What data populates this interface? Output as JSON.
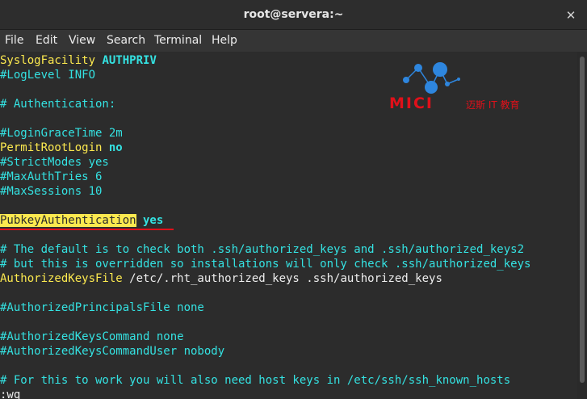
{
  "window": {
    "title": "root@servera:~",
    "close_glyph": "✕"
  },
  "menubar": {
    "items": [
      "File",
      "Edit",
      "View",
      "Search",
      "Terminal",
      "Help"
    ]
  },
  "terminal": {
    "lines": {
      "l01_key": "SyslogFacility",
      "l01_val": " AUTHPRIV",
      "l02": "#LogLevel INFO",
      "l04": "# Authentication:",
      "l06": "#LoginGraceTime 2m",
      "l07_key": "PermitRootLogin",
      "l07_val": " no",
      "l08": "#StrictModes yes",
      "l09": "#MaxAuthTries 6",
      "l10": "#MaxSessions 10",
      "l12_key": "PubkeyAuthentication",
      "l12_val": " yes",
      "l14": "# The default is to check both .ssh/authorized_keys and .ssh/authorized_keys2",
      "l15": "# but this is overridden so installations will only check .ssh/authorized_keys",
      "l16_key": "AuthorizedKeysFile",
      "l16_val": " /etc/.rht_authorized_keys .ssh/authorized_keys",
      "l18": "#AuthorizedPrincipalsFile none",
      "l20": "#AuthorizedKeysCommand none",
      "l21": "#AuthorizedKeysCommandUser nobody",
      "l23": "# For this to work you will also need host keys in /etc/ssh/ssh_known_hosts",
      "command": ":wq"
    }
  },
  "watermark": {
    "brand": "MICI",
    "subtitle": "迈斯 IT 教育"
  },
  "colors": {
    "comment": "#34e2e2",
    "keyword": "#fce94f",
    "highlight_bg": "#fce94f",
    "annotation_red": "#e0101a",
    "background": "#2c2c2c"
  }
}
